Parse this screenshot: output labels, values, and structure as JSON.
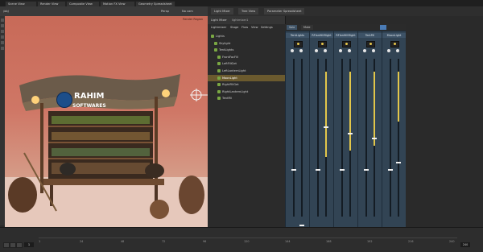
{
  "viewport_tabs": [
    "Scene View",
    "Render View",
    "Composite View",
    "Motion FX View",
    "Geometry Spreadsheet"
  ],
  "right_tabs": [
    "Light Mixer",
    "Tree View",
    "Parameter Spreadsheet"
  ],
  "viewport_toolbar": {
    "obj": "/obj",
    "camera": "Persp",
    "no_cam": "No cam"
  },
  "panel_tabs": {
    "light_mixer": "Light Mixer",
    "lightmixer": "lightmixer1"
  },
  "menu": [
    "Lightmixer",
    "Stage",
    "Flow",
    "View",
    "Settings"
  ],
  "tree": {
    "header": "Lights",
    "items": [
      "Lights",
      "Skylight",
      "TentLights",
      "FrontFacFill",
      "LeftFillGet",
      "LeftLanternLight",
      "MoonLight",
      "RightFillGet",
      "RightLanternLight",
      "TentFill"
    ],
    "selected": 6
  },
  "mixer": {
    "tabs": [
      "Solo",
      "Mute"
    ],
    "group_name": "TentLights",
    "strips": [
      {
        "name": "TentLights",
        "level": 0.0,
        "swatch": "#f0e68c"
      },
      {
        "name": "RFlanHiltRight",
        "level": 0.62,
        "swatch": "#e25b2c"
      },
      {
        "name": "RFlanHiltRight",
        "level": 0.58,
        "swatch": "#e8722f"
      },
      {
        "name": "TentFill",
        "level": 0.55,
        "swatch": "#e07a2e"
      },
      {
        "name": "MoonLight",
        "level": 0.4,
        "swatch": "#d84a2a"
      }
    ]
  },
  "viewport": {
    "watermark_line1": "RAHIM",
    "watermark_line2": "SOFTWARES",
    "corner_label": "Render Region"
  },
  "timeline": {
    "frame": "1",
    "start": "1",
    "end": "240",
    "ticks": [
      "1",
      "24",
      "48",
      "72",
      "96",
      "120",
      "144",
      "168",
      "192",
      "216",
      "240"
    ]
  }
}
